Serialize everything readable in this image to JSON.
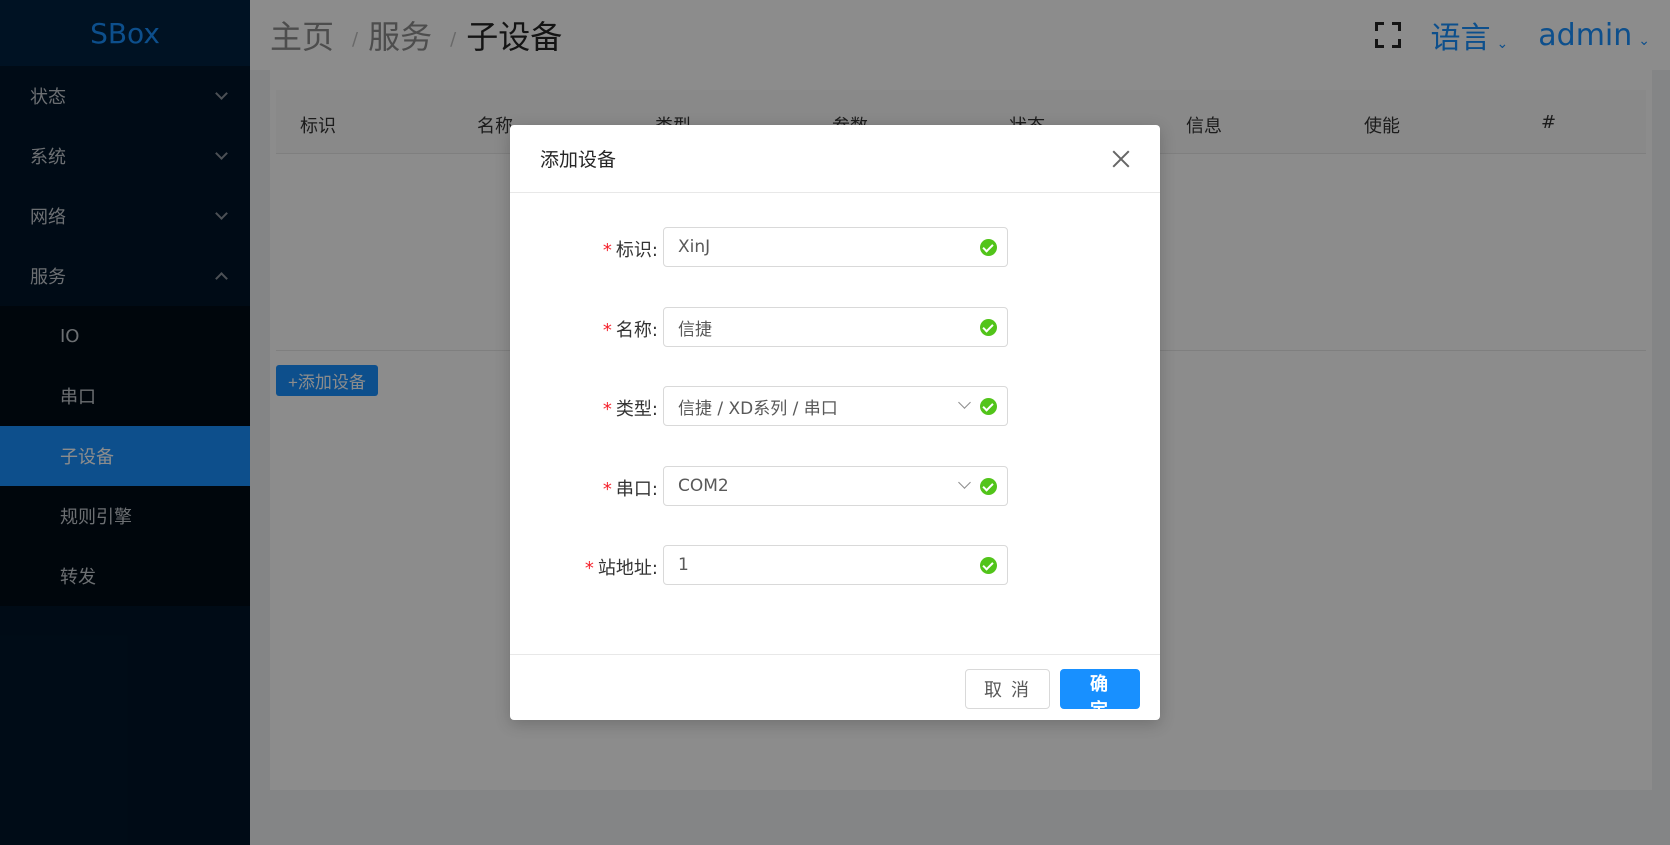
{
  "sidebar": {
    "logo": "SBox",
    "menu": [
      {
        "label": "状态"
      },
      {
        "label": "系统"
      },
      {
        "label": "网络"
      },
      {
        "label": "服务"
      }
    ],
    "submenu": [
      {
        "label": "IO"
      },
      {
        "label": "串口"
      },
      {
        "label": "子设备"
      },
      {
        "label": "规则引擎"
      },
      {
        "label": "转发"
      }
    ]
  },
  "header": {
    "breadcrumb": [
      "主页",
      "服务",
      "子设备"
    ],
    "separator": "/",
    "language": "语言",
    "user": "admin"
  },
  "table": {
    "columns": [
      "标识",
      "名称",
      "类型",
      "参数",
      "状态",
      "信息",
      "使能",
      "#"
    ],
    "add_button": "+添加设备"
  },
  "dialog": {
    "title": "添加设备",
    "required_mark": "*",
    "fields": [
      {
        "label": "标识:",
        "value": "XinJ"
      },
      {
        "label": "名称:",
        "value": "信捷"
      },
      {
        "label": "类型:",
        "value": "信捷 / XD系列 / 串口"
      },
      {
        "label": "串口:",
        "value": "COM2"
      },
      {
        "label": "站地址:",
        "value": "1"
      }
    ],
    "cancel": "取 消",
    "ok": "确 定"
  },
  "colors": {
    "accent": "#1890ff",
    "sidebar_bg": "#001529",
    "success": "#52c41a",
    "required": "#f5222d"
  }
}
